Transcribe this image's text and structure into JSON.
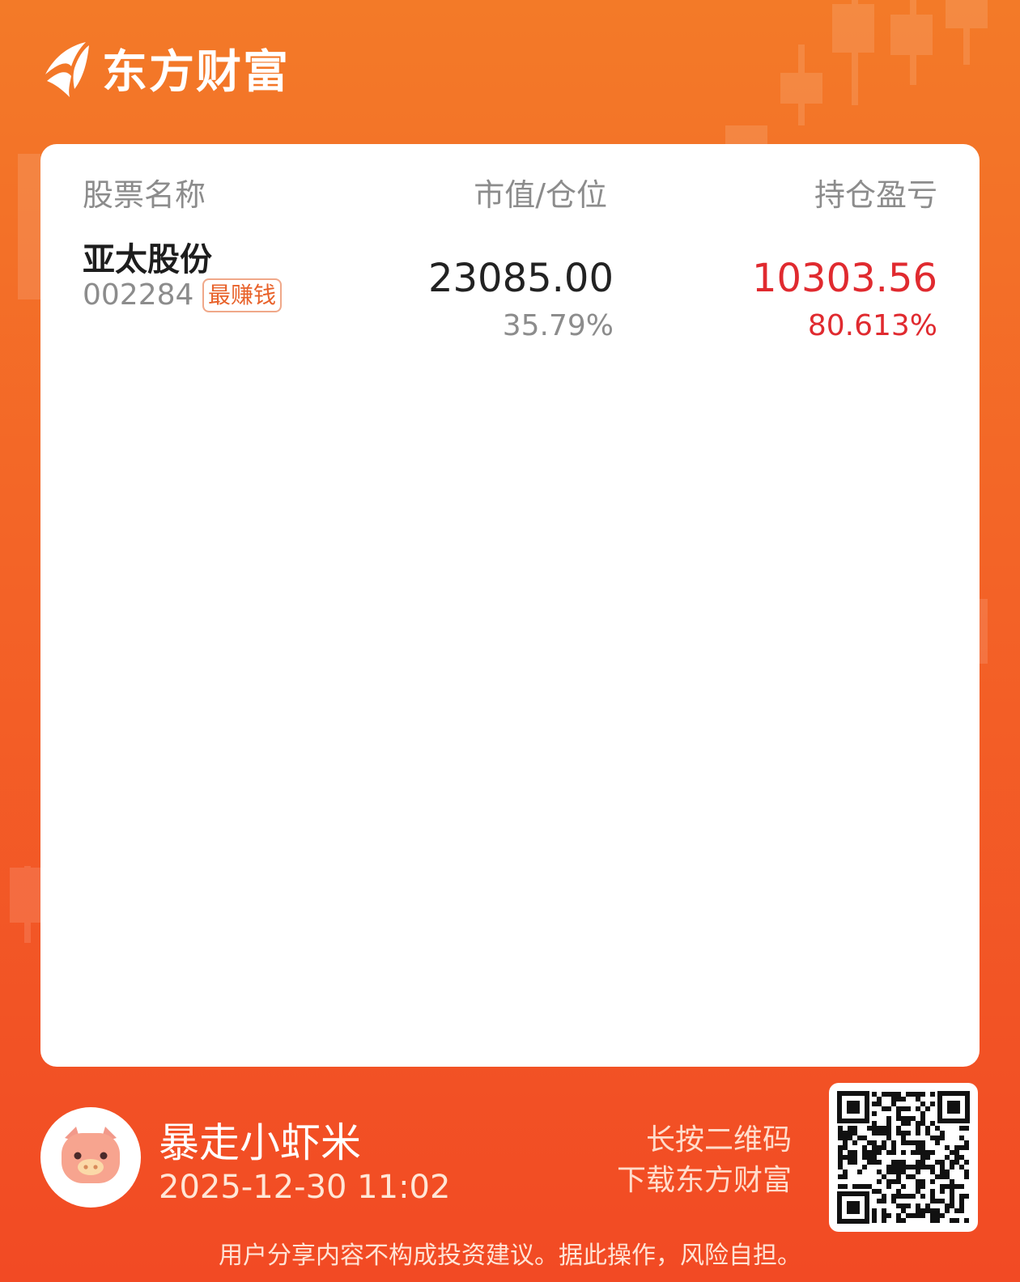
{
  "brand": {
    "name": "东方财富"
  },
  "table": {
    "headers": {
      "name": "股票名称",
      "value": "市值/仓位",
      "pnl": "持仓盈亏"
    },
    "rows": [
      {
        "name": "亚太股份",
        "code": "002284",
        "badge": "最赚钱",
        "market_value": "23085.00",
        "position": "35.79%",
        "pnl": "10303.56",
        "pnl_pct": "80.613%"
      }
    ]
  },
  "user": {
    "name": "暴走小虾米",
    "datetime": "2025-12-30 11:02"
  },
  "qr": {
    "line1": "长按二维码",
    "line2": "下载东方财富"
  },
  "disclaimer": "用户分享内容不构成投资建议。据此操作，风险自担。",
  "colors": {
    "accent": "#f36a27",
    "profit": "#e02a2f",
    "muted": "#8c8c8c"
  }
}
